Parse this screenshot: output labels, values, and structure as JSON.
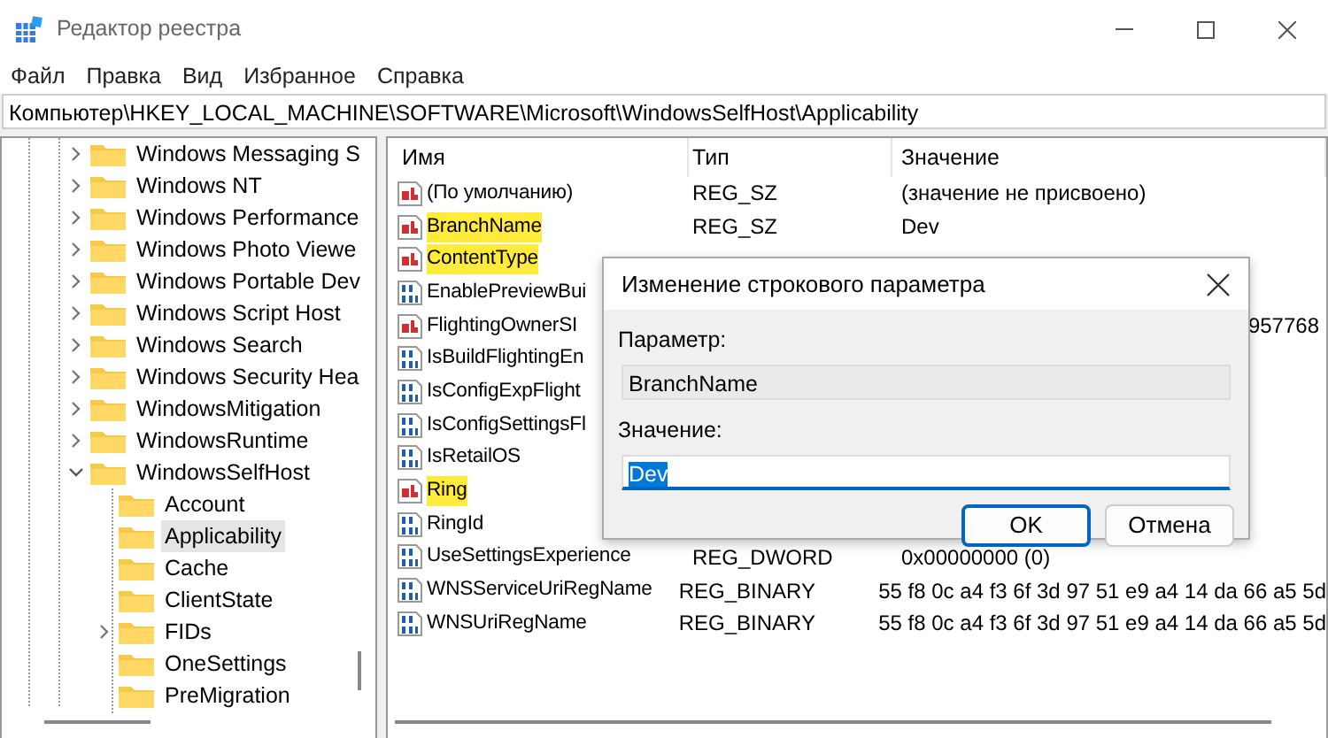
{
  "window": {
    "title": "Редактор реестра"
  },
  "menu": [
    "Файл",
    "Правка",
    "Вид",
    "Избранное",
    "Справка"
  ],
  "address": "Компьютер\\HKEY_LOCAL_MACHINE\\SOFTWARE\\Microsoft\\WindowsSelfHost\\Applicability",
  "tree": [
    {
      "label": "Windows Messaging S",
      "has_children": true,
      "expanded": false,
      "selected": false
    },
    {
      "label": "Windows NT",
      "has_children": true,
      "expanded": false,
      "selected": false
    },
    {
      "label": "Windows Performance",
      "has_children": true,
      "expanded": false,
      "selected": false
    },
    {
      "label": "Windows Photo Viewe",
      "has_children": true,
      "expanded": false,
      "selected": false
    },
    {
      "label": "Windows Portable Dev",
      "has_children": true,
      "expanded": false,
      "selected": false
    },
    {
      "label": "Windows Script Host",
      "has_children": true,
      "expanded": false,
      "selected": false
    },
    {
      "label": "Windows Search",
      "has_children": true,
      "expanded": false,
      "selected": false
    },
    {
      "label": "Windows Security Hea",
      "has_children": true,
      "expanded": false,
      "selected": false
    },
    {
      "label": "WindowsMitigation",
      "has_children": true,
      "expanded": false,
      "selected": false
    },
    {
      "label": "WindowsRuntime",
      "has_children": true,
      "expanded": false,
      "selected": false
    },
    {
      "label": "WindowsSelfHost",
      "has_children": true,
      "expanded": true,
      "selected": false,
      "children": [
        {
          "label": "Account",
          "has_children": false,
          "selected": false
        },
        {
          "label": "Applicability",
          "has_children": false,
          "selected": true
        },
        {
          "label": "Cache",
          "has_children": false,
          "selected": false
        },
        {
          "label": "ClientState",
          "has_children": false,
          "selected": false
        },
        {
          "label": "FIDs",
          "has_children": true,
          "expanded": false,
          "selected": false
        },
        {
          "label": "OneSettings",
          "has_children": false,
          "selected": false
        },
        {
          "label": "PreMigration",
          "has_children": false,
          "selected": false
        }
      ]
    }
  ],
  "table": {
    "columns": [
      "Имя",
      "Тип",
      "Значение"
    ],
    "rows": [
      {
        "kind": "string",
        "name": "(По умолчанию)",
        "type": "REG_SZ",
        "value": "(значение не присвоено)",
        "highlighted": false
      },
      {
        "kind": "string",
        "name": "BranchName",
        "type": "REG_SZ",
        "value": "Dev",
        "highlighted": true
      },
      {
        "kind": "string",
        "name": "ContentType",
        "highlighted": true
      },
      {
        "kind": "binary",
        "name": "EnablePreviewBui",
        "highlighted": false
      },
      {
        "kind": "string",
        "name": "FlightingOwnerSI",
        "value": "957768",
        "highlighted": false
      },
      {
        "kind": "binary",
        "name": "IsBuildFlightingEn",
        "highlighted": false
      },
      {
        "kind": "binary",
        "name": "IsConfigExpFlight",
        "highlighted": false
      },
      {
        "kind": "binary",
        "name": "IsConfigSettingsFl",
        "highlighted": false
      },
      {
        "kind": "binary",
        "name": "IsRetailOS",
        "highlighted": false
      },
      {
        "kind": "string",
        "name": "Ring",
        "highlighted": true
      },
      {
        "kind": "binary",
        "name": "RingId",
        "highlighted": false
      },
      {
        "kind": "binary",
        "name": "UseSettingsExperience",
        "type": "REG_DWORD",
        "value": "0x00000000 (0)",
        "highlighted": false
      },
      {
        "kind": "binary",
        "name": "WNSServiceUriRegName",
        "type": "REG_BINARY",
        "value": "55 f8 0c a4 f3 6f 3d 97 51 e9 a4 14 da 66 a5 5d",
        "highlighted": false
      },
      {
        "kind": "binary",
        "name": "WNSUriRegName",
        "type": "REG_BINARY",
        "value": "55 f8 0c a4 f3 6f 3d 97 51 e9 a4 14 da 66 a5 5d",
        "highlighted": false
      }
    ]
  },
  "dialog": {
    "title": "Изменение строкового параметра",
    "param_label": "Параметр:",
    "param_value": "BranchName",
    "value_label": "Значение:",
    "value": "Dev",
    "buttons": [
      "OK",
      "Отмена"
    ]
  }
}
